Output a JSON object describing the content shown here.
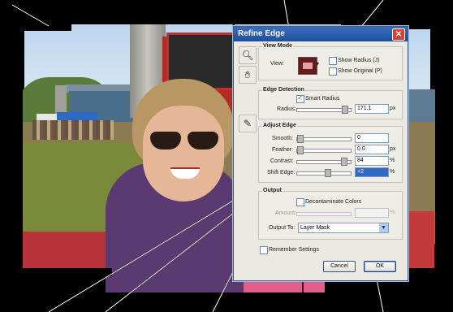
{
  "dialog": {
    "title": "Refine Edge",
    "view_mode": {
      "title": "View Mode",
      "view_label": "View:",
      "show_radius": {
        "label": "Show Radius (J)",
        "checked": false
      },
      "show_original": {
        "label": "Show Original (P)",
        "checked": false
      }
    },
    "edge_detection": {
      "title": "Edge Detection",
      "smart_radius": {
        "label": "Smart Radius",
        "checked": true
      },
      "radius": {
        "label": "Radius:",
        "value": "171.1",
        "unit": "px",
        "fraction": 0.86
      }
    },
    "adjust_edge": {
      "title": "Adjust Edge",
      "smooth": {
        "label": "Smooth:",
        "value": "0",
        "unit": "",
        "fraction": 0.0
      },
      "feather": {
        "label": "Feather:",
        "value": "0.0",
        "unit": "px",
        "fraction": 0.0
      },
      "contrast": {
        "label": "Contrast:",
        "value": "84",
        "unit": "%",
        "fraction": 0.84
      },
      "shift_edge": {
        "label": "Shift Edge:",
        "value": "+2",
        "unit": "%",
        "fraction": 0.52
      }
    },
    "output": {
      "title": "Output",
      "decontaminate": {
        "label": "Decontaminate Colors",
        "checked": false
      },
      "amount": {
        "label": "Amount:",
        "value": "",
        "unit": "%"
      },
      "output_to": {
        "label": "Output To:",
        "value": "Layer Mask"
      }
    },
    "remember_settings": {
      "label": "Remember Settings",
      "checked": false
    },
    "buttons": {
      "cancel": "Cancel",
      "ok": "OK"
    }
  },
  "icons": {
    "tool_hand": "hand-icon",
    "tool_zoom": "zoom-icon",
    "tool_brush": "refine-radius-brush-icon",
    "close": "close-icon"
  }
}
